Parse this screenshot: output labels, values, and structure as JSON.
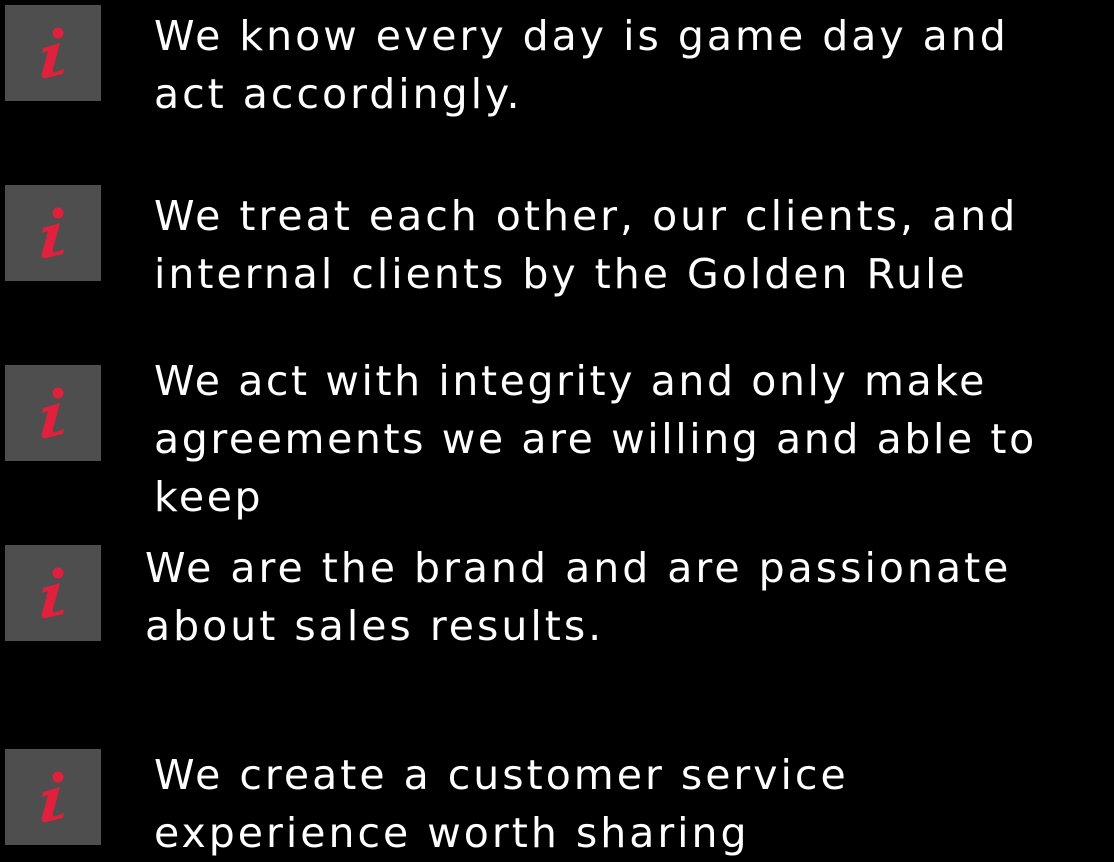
{
  "colors": {
    "background": "#000000",
    "badge_background": "#4e4e4e",
    "icon_color": "#e0203c",
    "text_color": "#ffffff"
  },
  "values": [
    {
      "icon": "info-icon",
      "text": "We know every day is game day and\nact accordingly."
    },
    {
      "icon": "info-icon",
      "text": "We treat each other, our clients, and\ninternal clients by the Golden Rule"
    },
    {
      "icon": "info-icon",
      "text": "We act with integrity and only make\nagreements we are willing and able to keep"
    },
    {
      "icon": "info-icon",
      "text": "We are the brand and are passionate\nabout sales results."
    },
    {
      "icon": "info-icon",
      "text": "We create a customer service\nexperience worth sharing"
    }
  ]
}
